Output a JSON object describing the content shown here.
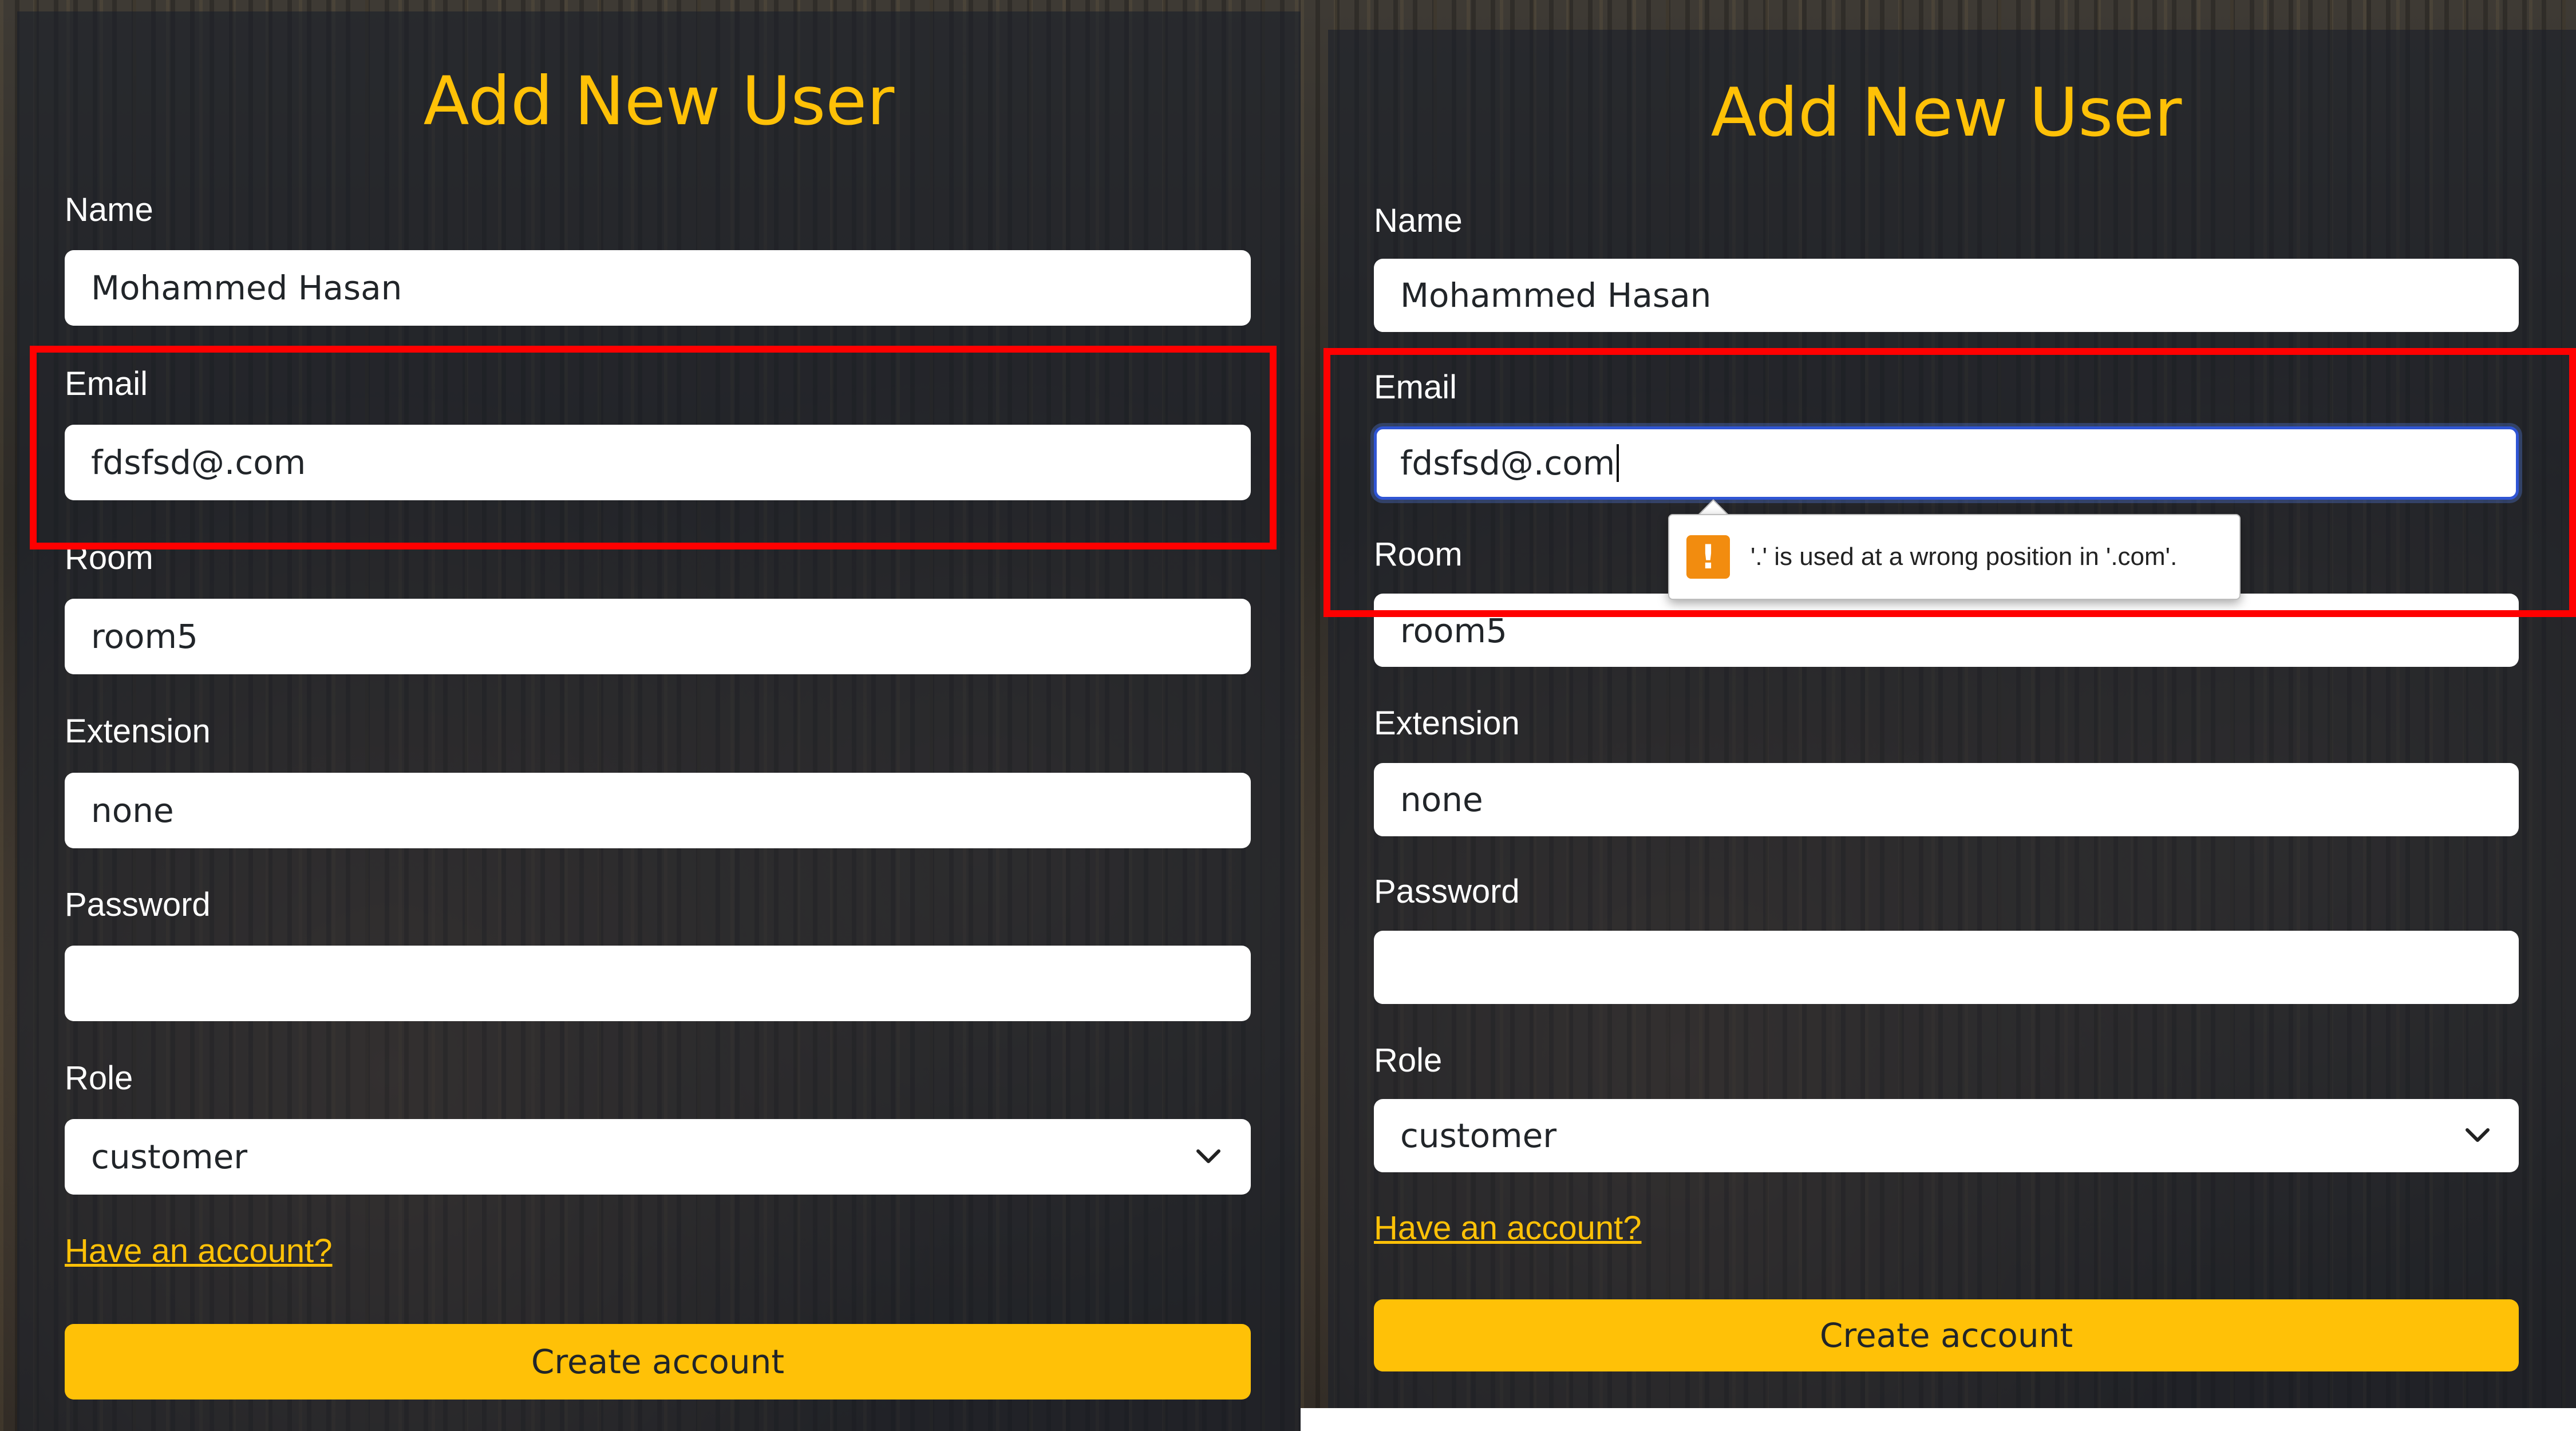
{
  "left": {
    "title": "Add New User",
    "name_label": "Name",
    "name_value": "Mohammed Hasan",
    "email_label": "Email",
    "email_value": "fdsfsd@.com",
    "room_label": "Room",
    "room_value": "room5",
    "extension_label": "Extension",
    "extension_value": "none",
    "password_label": "Password",
    "password_value": "",
    "role_label": "Role",
    "role_selected": "customer",
    "have_account_link": "Have an account?",
    "create_button": "Create account"
  },
  "right": {
    "title": "Add New User",
    "name_label": "Name",
    "name_value": "Mohammed Hasan",
    "email_label": "Email",
    "email_value": "fdsfsd@.com",
    "room_label": "Room",
    "room_value": "room5",
    "extension_label": "Extension",
    "extension_value": "none",
    "password_label": "Password",
    "password_value": "",
    "role_label": "Role",
    "role_selected": "customer",
    "have_account_link": "Have an account?",
    "create_button": "Create account",
    "validation_tooltip": {
      "icon": "warning-icon",
      "icon_glyph": "!",
      "message": "'.' is used at a wrong position in '.com'."
    }
  },
  "colors": {
    "accent": "#ffc107",
    "highlight_box": "#ff0000",
    "warning": "#f28c0f",
    "focus_border": "#2f55d4"
  }
}
